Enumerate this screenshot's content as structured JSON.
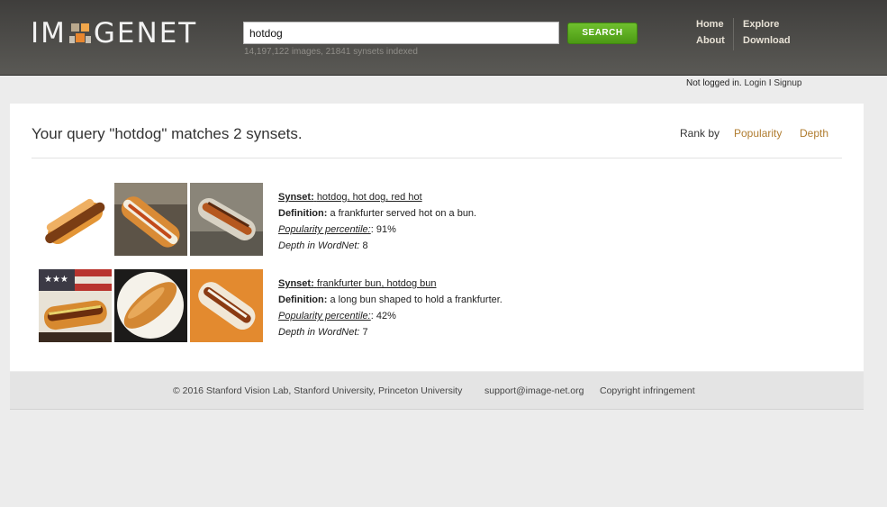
{
  "header": {
    "logo_left": "IM",
    "logo_right": "GENET",
    "search_value": "hotdog",
    "search_button": "SEARCH",
    "index_info": "14,197,122 images, 21841 synsets indexed",
    "nav": {
      "home": "Home",
      "explore": "Explore",
      "about": "About",
      "download": "Download"
    }
  },
  "login": {
    "status": "Not logged in.",
    "login": "Login",
    "separator": "I",
    "signup": "Signup"
  },
  "main": {
    "query_title": "Your query \"hotdog\" matches 2 synsets.",
    "rank_by": "Rank by",
    "rank_popularity": "Popularity",
    "rank_depth": "Depth",
    "results": [
      {
        "synset_label": "Synset:",
        "synset": "hotdog, hot dog, red hot",
        "definition_label": "Definition:",
        "definition": "a frankfurter served hot on a bun.",
        "popularity_label": "Popularity percentile:",
        "popularity_suffix": ":",
        "popularity": "91%",
        "depth_label": "Depth in WordNet:",
        "depth": "8"
      },
      {
        "synset_label": "Synset:",
        "synset": "frankfurter bun, hotdog bun",
        "definition_label": "Definition:",
        "definition": "a long bun shaped to hold a frankfurter.",
        "popularity_label": "Popularity percentile:",
        "popularity_suffix": ":",
        "popularity": "42%",
        "depth_label": "Depth in WordNet:",
        "depth": "7"
      }
    ]
  },
  "footer": {
    "copyright": "© 2016 Stanford Vision Lab, Stanford University, Princeton University",
    "support": "support@image-net.org",
    "copyright_link": "Copyright infringement"
  },
  "colors": {
    "accent_orange": "#e8862e",
    "search_green": "#5aab1e",
    "rank_link": "#b07c2f"
  }
}
